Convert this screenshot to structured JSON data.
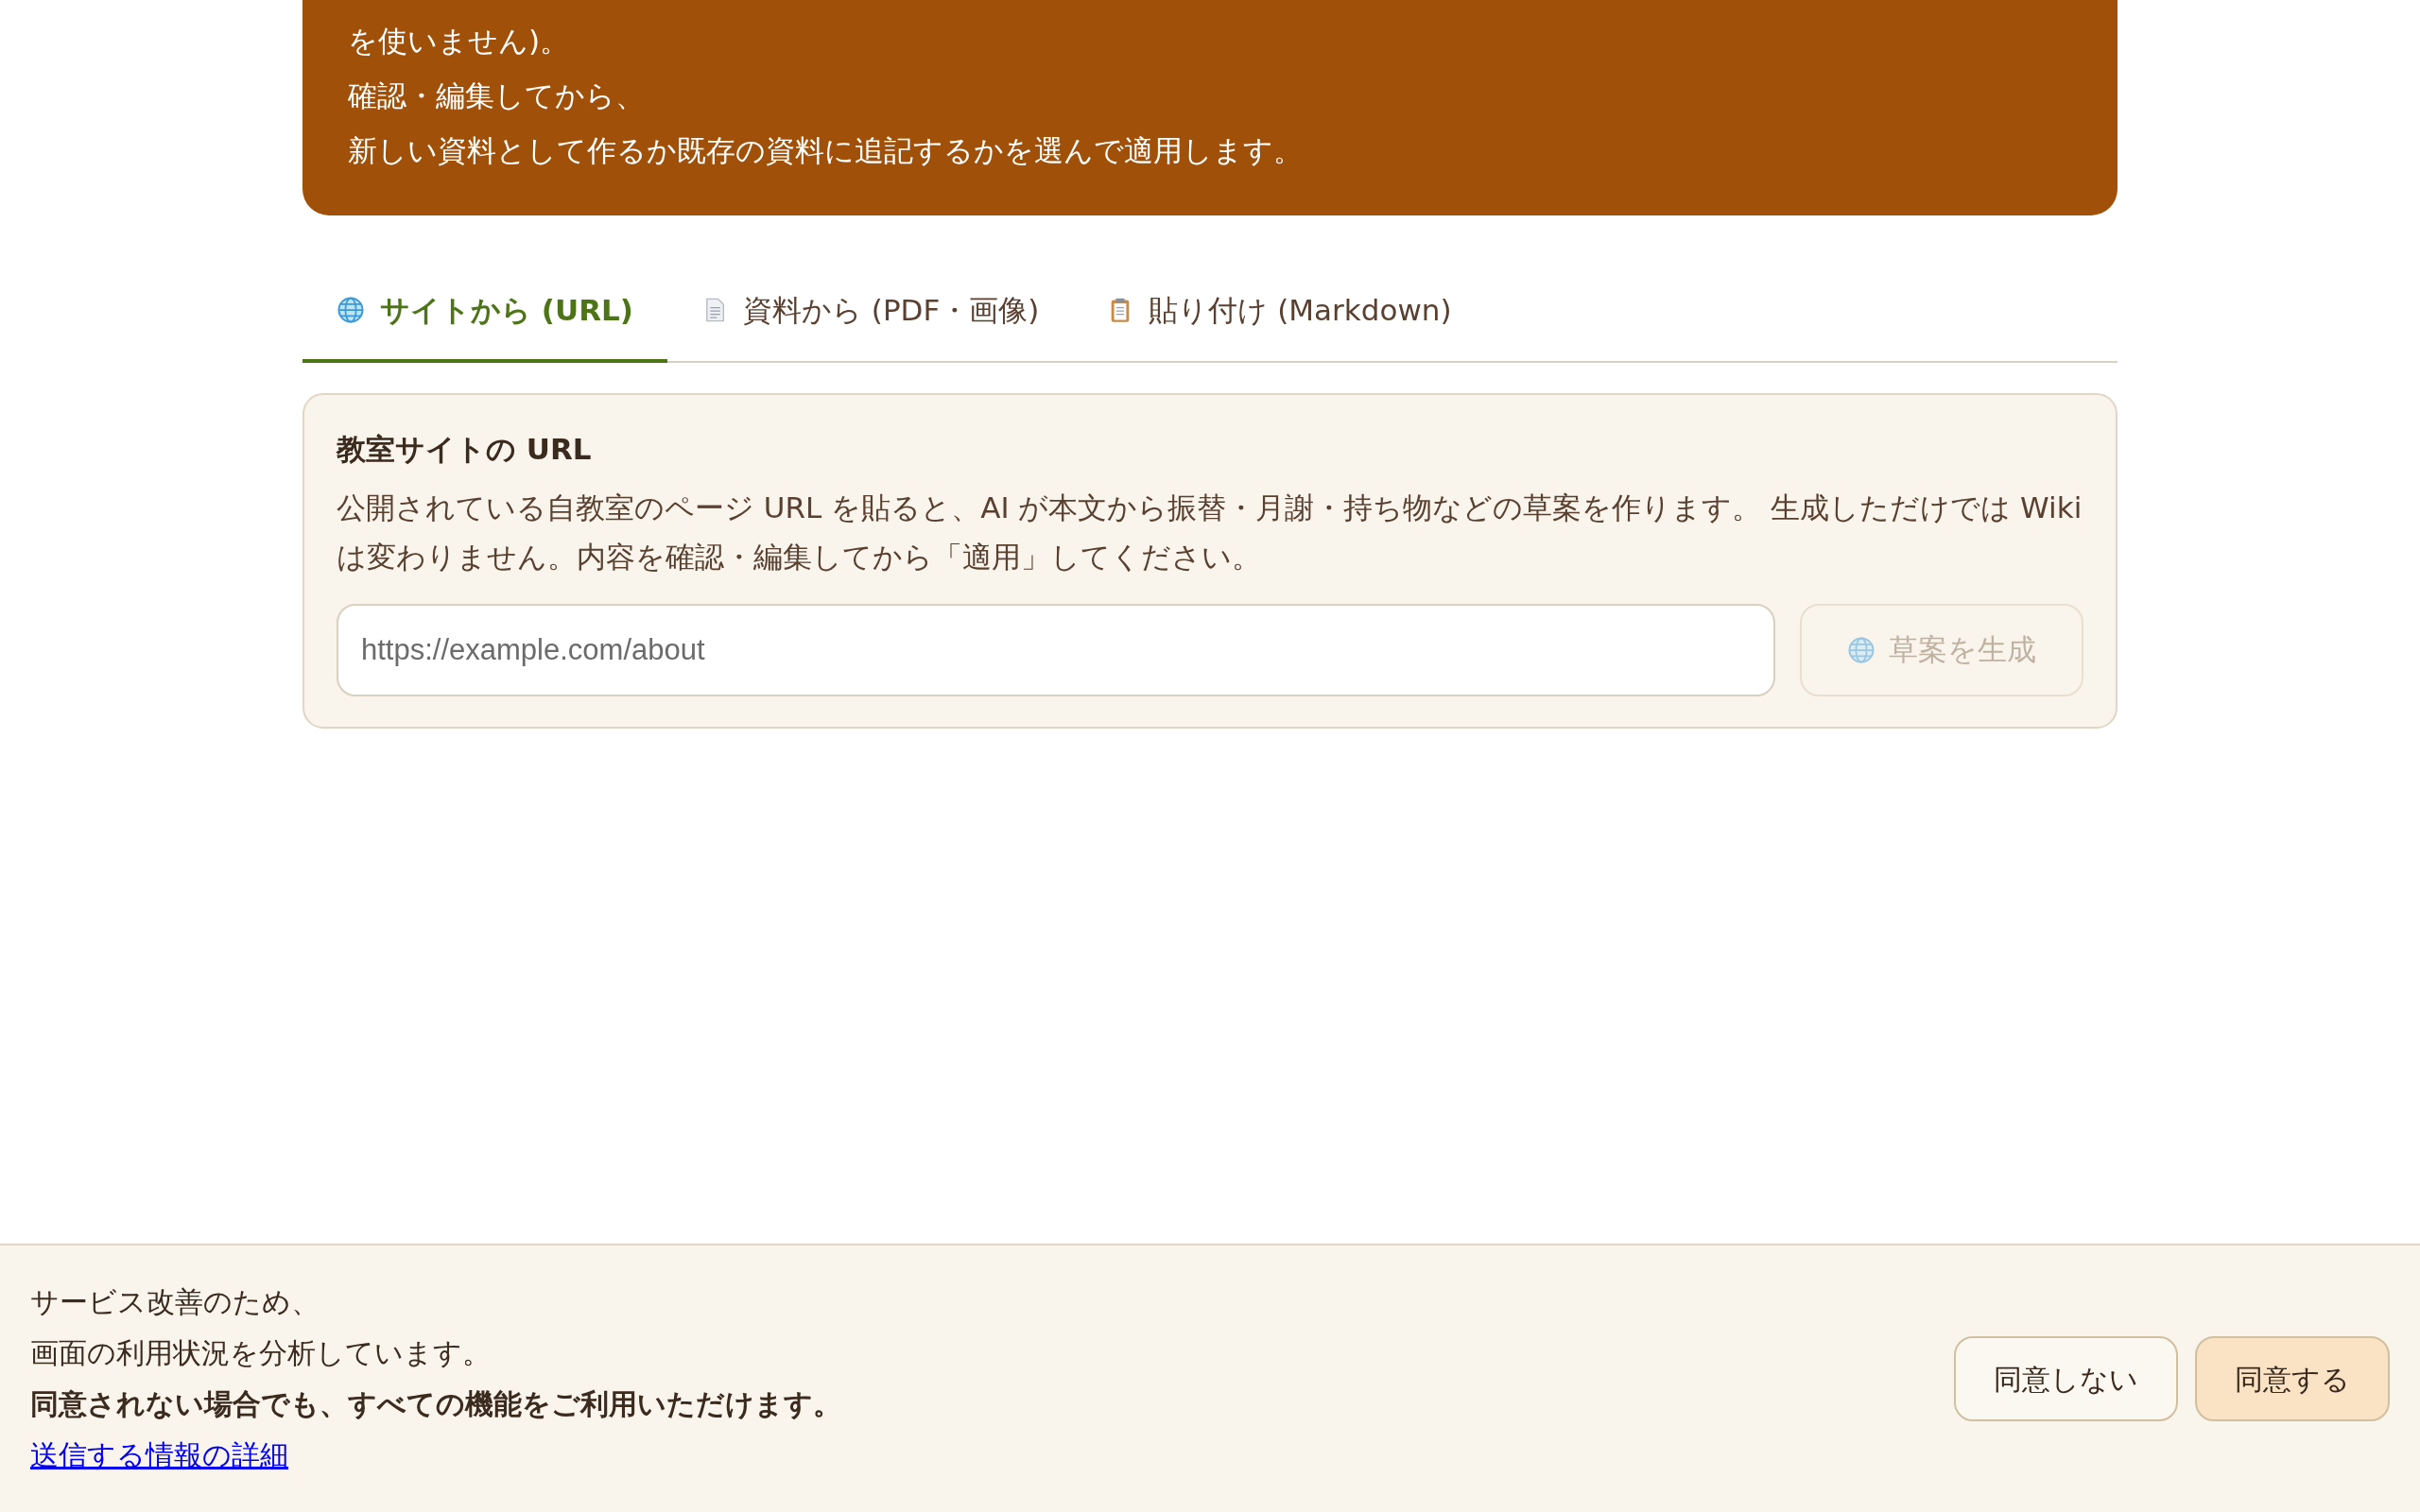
{
  "banner": {
    "lines": [
      "を使いません)。",
      "確認・編集してから、",
      "新しい資料として作るか既存の資料に追記するかを選んで適用します。"
    ]
  },
  "tabs": [
    {
      "kind": "globe",
      "label": "サイトから (URL)",
      "selected": true
    },
    {
      "kind": "document",
      "label": "資料から (PDF・画像)",
      "selected": false
    },
    {
      "kind": "clipboard",
      "label": "貼り付け (Markdown)",
      "selected": false
    }
  ],
  "url_card": {
    "title": "教室サイトの URL",
    "description": "公開されている自教室のページ URL を貼ると、AI が本文から振替・月謝・持ち物などの草案を作ります。 生成しただけでは Wiki は変わりません。内容を確認・編集してから「適用」してください。",
    "url_field": {
      "placeholder": "https://example.com/about"
    },
    "generate_button": {
      "label": "草案を生成",
      "disabled": true
    }
  },
  "consent_bar": {
    "lines": [
      "サービス改善のため、",
      "画面の利用状況を分析しています。"
    ],
    "note": "同意されない場合でも、すべての機能をご利用いただけます。",
    "details_link": "送信する情報の詳細",
    "buttons": [
      {
        "label": "同意しない",
        "kind": "decline"
      },
      {
        "label": "同意する",
        "kind": "accept"
      }
    ]
  }
}
